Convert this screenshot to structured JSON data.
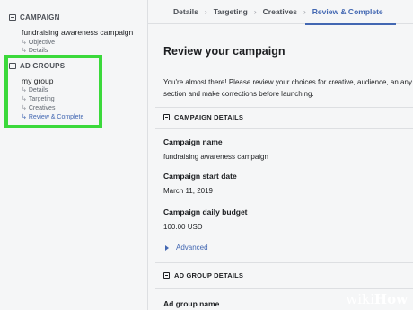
{
  "sidebar": {
    "campaign_header": "CAMPAIGN",
    "campaign_name": "fundraising awareness campaign",
    "campaign_subitems": [
      "Objective",
      "Details"
    ],
    "adgroups_header": "AD GROUPS",
    "group_name": "my group",
    "group_subitems": [
      "Details",
      "Targeting",
      "Creatives",
      "Review & Complete"
    ],
    "arrow": "↳"
  },
  "breadcrumb": {
    "items": [
      "Details",
      "Targeting",
      "Creatives",
      "Review & Complete"
    ],
    "separator": "›",
    "active_index": 3
  },
  "main": {
    "title": "Review your campaign",
    "intro": "You're almost there! Please review your choices for creative, audience, an any section and make corrections before launching.",
    "campaign_details_header": "CAMPAIGN DETAILS",
    "fields": [
      {
        "label": "Campaign name",
        "value": "fundraising awareness campaign"
      },
      {
        "label": "Campaign start date",
        "value": "March 11, 2019"
      },
      {
        "label": "Campaign daily budget",
        "value": "100.00 USD"
      }
    ],
    "advanced_label": "Advanced",
    "ad_group_details_header": "AD GROUP DETAILS",
    "ad_group_name_label": "Ad group name"
  },
  "watermark": {
    "part1": "wiki",
    "part2": "How"
  },
  "colors": {
    "accent": "#4267b2",
    "highlight": "#3bd93b"
  }
}
